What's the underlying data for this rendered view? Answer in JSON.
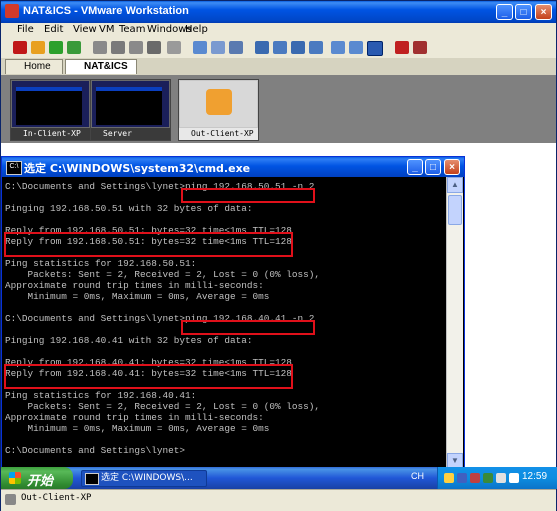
{
  "window": {
    "title": "NAT&ICS - VMware Workstation"
  },
  "menu": [
    "File",
    "Edit",
    "View",
    "VM",
    "Team",
    "Windows",
    "Help"
  ],
  "tabs": [
    {
      "label": "Home",
      "active": false
    },
    {
      "label": "NAT&ICS",
      "active": true
    }
  ],
  "thumbnails": [
    {
      "label": "In-Client-XP"
    },
    {
      "label": "Server"
    },
    {
      "label": "Out-Client-XP"
    }
  ],
  "cmd": {
    "title": "选定 C:\\WINDOWS\\system32\\cmd.exe",
    "lines": [
      "C:\\Documents and Settings\\lynet>ping 192.168.50.51 -n 2",
      "",
      "Pinging 192.168.50.51 with 32 bytes of data:",
      "",
      "Reply from 192.168.50.51: bytes=32 time<1ms TTL=128",
      "Reply from 192.168.50.51: bytes=32 time<1ms TTL=128",
      "",
      "Ping statistics for 192.168.50.51:",
      "    Packets: Sent = 2, Received = 2, Lost = 0 (0% loss),",
      "Approximate round trip times in milli-seconds:",
      "    Minimum = 0ms, Maximum = 0ms, Average = 0ms",
      "",
      "C:\\Documents and Settings\\lynet>ping 192.168.40.41 -n 2",
      "",
      "Pinging 192.168.40.41 with 32 bytes of data:",
      "",
      "Reply from 192.168.40.41: bytes=32 time<1ms TTL=128",
      "Reply from 192.168.40.41: bytes=32 time<1ms TTL=128",
      "",
      "Ping statistics for 192.168.40.41:",
      "    Packets: Sent = 2, Received = 2, Lost = 0 (0% loss),",
      "Approximate round trip times in milli-seconds:",
      "    Minimum = 0ms, Maximum = 0ms, Average = 0ms",
      "",
      "C:\\Documents and Settings\\lynet>"
    ]
  },
  "taskbar": {
    "start_label": "开始",
    "task_label": "选定 C:\\WINDOWS\\...",
    "lang": "CH",
    "clock": "12:59"
  },
  "statusbar": {
    "text": "Out-Client-XP"
  }
}
